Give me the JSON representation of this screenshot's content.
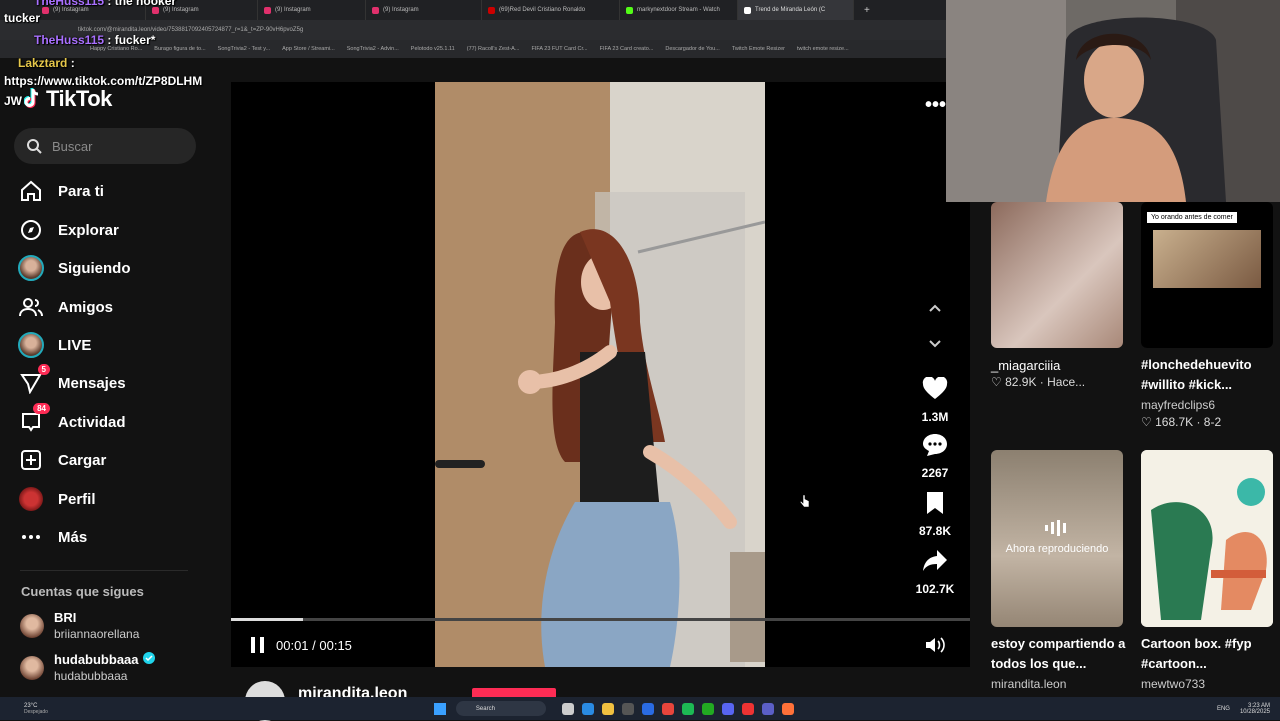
{
  "browser": {
    "tabs": [
      {
        "label": "(9) Instagram",
        "color": "#e1306c"
      },
      {
        "label": "(9) Instagram",
        "color": "#e1306c"
      },
      {
        "label": "(9) Instagram",
        "color": "#e1306c"
      },
      {
        "label": "(9) Instagram",
        "color": "#e1306c"
      },
      {
        "label": "(69)Red Devil Cristiano Ronaldo",
        "color": "#c00"
      },
      {
        "label": "markynextdoor Stream - Watch",
        "color": "#53fc18"
      },
      {
        "label": "Trend de Miranda León (C",
        "color": "#fff"
      }
    ],
    "url": "tiktok.com/@mirandita.leon/video/7538817092405724877_r=1&_t=ZP-90vH6pvoZ5g",
    "bookmarks": [
      "Happy Cristiano Ro...",
      "Burago figura de to...",
      "SongTrivia2 - Test y...",
      "App Store / Streami...",
      "SongTrivia2 - Advin...",
      "Pelotodo v25.1.11",
      "(77) Racoll's Zest-A...",
      "FIFA 23 FUT Card Cr...",
      "FIFA 23 Card creato...",
      "Descargador de You...",
      "Twitch Emote Resizer",
      "twitch emote resize..."
    ]
  },
  "chat": {
    "line1_user": "TheHuss115",
    "line1_text": ": the hooker",
    "line2": "tucker",
    "line3_user": "TheHuss115",
    "line3_text": ": fucker*",
    "line4_user": "Lakztard",
    "line4_text": ":",
    "line5": "https://www.tiktok.com/t/ZP8DLHM",
    "line6": "JW"
  },
  "sidebar": {
    "logo": "TikTok",
    "search_placeholder": "Buscar",
    "nav": [
      {
        "label": "Para ti",
        "icon": "home-icon"
      },
      {
        "label": "Explorar",
        "icon": "compass-icon"
      },
      {
        "label": "Siguiendo",
        "icon": "avatar"
      },
      {
        "label": "Amigos",
        "icon": "friends-icon"
      },
      {
        "label": "LIVE",
        "icon": "avatar"
      },
      {
        "label": "Mensajes",
        "icon": "send-icon",
        "badge": "5"
      },
      {
        "label": "Actividad",
        "icon": "inbox-icon",
        "badge": "84"
      },
      {
        "label": "Cargar",
        "icon": "plus-square-icon"
      },
      {
        "label": "Perfil",
        "icon": "profile-avatar"
      },
      {
        "label": "Más",
        "icon": "more-icon"
      }
    ],
    "following_heading": "Cuentas que sigues",
    "following": [
      {
        "name": "BRI",
        "handle": "briiannaorellana",
        "verified": false
      },
      {
        "name": "hudabubbaaa",
        "handle": "hudabubbaaa",
        "verified": true
      }
    ]
  },
  "player": {
    "time": "00:01 / 00:15",
    "progress": 0.097,
    "likes": "1.3M",
    "comments": "2267",
    "saves": "87.8K",
    "shares": "102.7K",
    "author": "mirandita.leon"
  },
  "right_grid": [
    {
      "caption": "_miagarciiia",
      "stats": "82.9K · Hace...",
      "style": "meta"
    },
    {
      "overlay_text": "Yo orando antes de comer",
      "caption": "#lonchedehuevito #willito #kick...",
      "author": "mayfredclips6",
      "stats": "168.7K · 8-2"
    },
    {
      "overlay_text": "Ahora reproduciendo",
      "caption": "estoy compartiendo a todos los que...",
      "author": "mirandita.leon"
    },
    {
      "caption": "Cartoon box. #fyp #cartoon...",
      "author": "mewtwo733"
    }
  ],
  "taskbar": {
    "weather": "23°C",
    "weather_sub": "Despejado",
    "search": "Search",
    "lang": "ENG",
    "time": "3:23 AM",
    "date": "10/28/2025"
  },
  "colors": {
    "accent": "#fe2c55",
    "verified": "#20d5ec"
  }
}
